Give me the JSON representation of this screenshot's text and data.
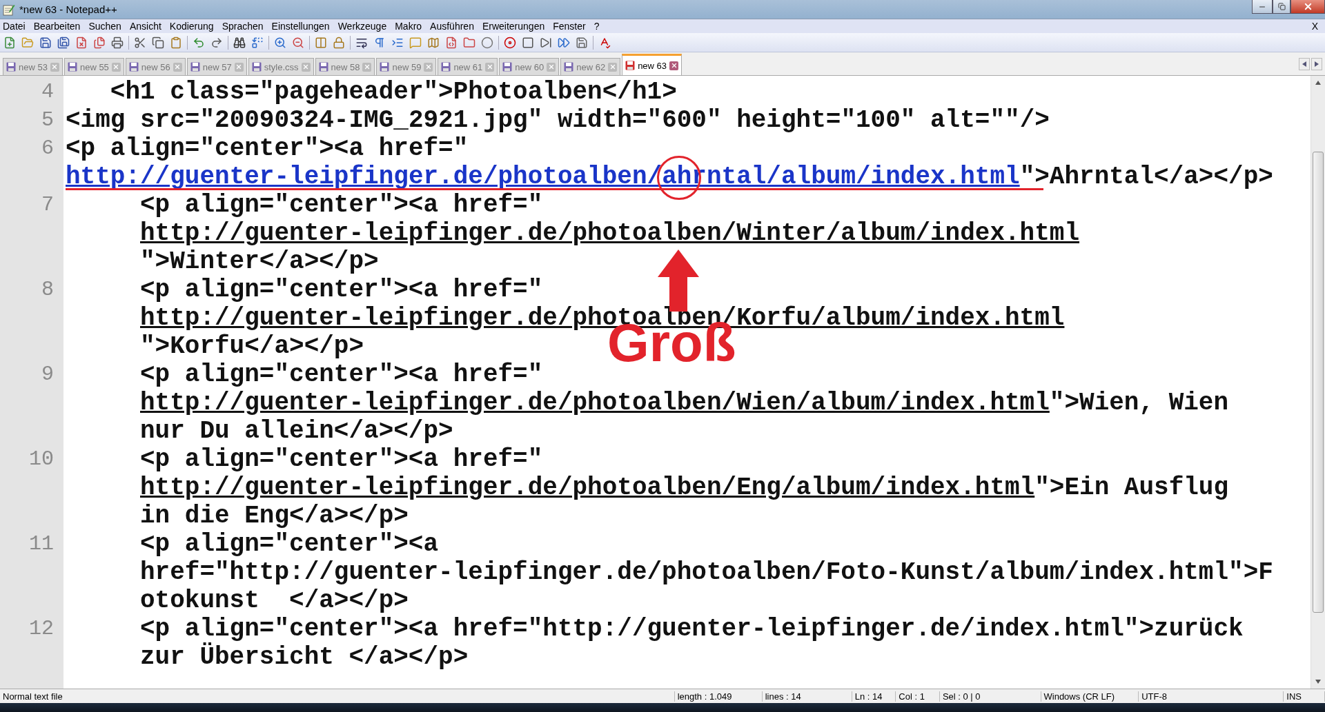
{
  "window": {
    "title": "*new 63 - Notepad++"
  },
  "menu": {
    "items": [
      "Datei",
      "Bearbeiten",
      "Suchen",
      "Ansicht",
      "Kodierung",
      "Sprachen",
      "Einstellungen",
      "Werkzeuge",
      "Makro",
      "Ausführen",
      "Erweiterungen",
      "Fenster",
      "?"
    ],
    "close": "X"
  },
  "tabs": [
    {
      "label": "new 53",
      "selected": false,
      "saved": true
    },
    {
      "label": "new 55",
      "selected": false,
      "saved": true
    },
    {
      "label": "new 56",
      "selected": false,
      "saved": true
    },
    {
      "label": "new 57",
      "selected": false,
      "saved": true
    },
    {
      "label": "style.css",
      "selected": false,
      "saved": true
    },
    {
      "label": "new 58",
      "selected": false,
      "saved": true
    },
    {
      "label": "new 59",
      "selected": false,
      "saved": true
    },
    {
      "label": "new 61",
      "selected": false,
      "saved": true
    },
    {
      "label": "new 60",
      "selected": false,
      "saved": true
    },
    {
      "label": "new 62",
      "selected": false,
      "saved": true
    },
    {
      "label": "new 63",
      "selected": true,
      "saved": false
    }
  ],
  "editor": {
    "lines": [
      {
        "number": "4",
        "indented": false,
        "rows": [
          [
            {
              "kind": "text",
              "text": "   <h1 class=\"pageheader\">Photoalben</h1>"
            }
          ]
        ]
      },
      {
        "number": "5",
        "indented": false,
        "rows": [
          [
            {
              "kind": "text",
              "text": "<img src=\"20090324-IMG_2921.jpg\" width=\"600\" height=\"100\" alt=\"\"/>"
            }
          ]
        ]
      },
      {
        "number": "6",
        "indented": false,
        "rows": [
          [
            {
              "kind": "text",
              "text": "<p align=\"center\"><a href=\""
            }
          ],
          [
            {
              "kind": "hover_link",
              "text": "http://guenter-leipfinger.de/photoalben/ahrntal/album/index.html"
            },
            {
              "kind": "text",
              "text": "\">Ahrntal</a></p>"
            }
          ]
        ]
      },
      {
        "number": "7",
        "indented": true,
        "rows": [
          [
            {
              "kind": "text",
              "text": "<p align=\"center\"><a href=\""
            }
          ],
          [
            {
              "kind": "link",
              "text": "http://guenter-leipfinger.de/photoalben/Winter/album/index.html"
            }
          ],
          [
            {
              "kind": "text",
              "text": "\">Winter</a></p>"
            }
          ]
        ]
      },
      {
        "number": "8",
        "indented": true,
        "rows": [
          [
            {
              "kind": "text",
              "text": "<p align=\"center\"><a href=\""
            }
          ],
          [
            {
              "kind": "link",
              "text": "http://guenter-leipfinger.de/photoalben/Korfu/album/index.html"
            }
          ],
          [
            {
              "kind": "text",
              "text": "\">Korfu</a></p>"
            }
          ]
        ]
      },
      {
        "number": "9",
        "indented": true,
        "rows": [
          [
            {
              "kind": "text",
              "text": "<p align=\"center\"><a href=\""
            }
          ],
          [
            {
              "kind": "link",
              "text": "http://guenter-leipfinger.de/photoalben/Wien/album/index.html"
            },
            {
              "kind": "text",
              "text": "\">Wien, Wien"
            }
          ],
          [
            {
              "kind": "text",
              "text": "nur Du allein</a></p>"
            }
          ]
        ]
      },
      {
        "number": "10",
        "indented": true,
        "rows": [
          [
            {
              "kind": "text",
              "text": "<p align=\"center\"><a href=\""
            }
          ],
          [
            {
              "kind": "link",
              "text": "http://guenter-leipfinger.de/photoalben/Eng/album/index.html"
            },
            {
              "kind": "text",
              "text": "\">Ein Ausflug"
            }
          ],
          [
            {
              "kind": "text",
              "text": "in die Eng</a></p>"
            }
          ]
        ]
      },
      {
        "number": "11",
        "indented": true,
        "rows": [
          [
            {
              "kind": "text",
              "text": "<p align=\"center\"><a"
            }
          ],
          [
            {
              "kind": "text",
              "text": "href=\"http://guenter-leipfinger.de/photoalben/Foto-Kunst/album/index.html\">F"
            }
          ],
          [
            {
              "kind": "text",
              "text": "otokunst  </a></p>"
            }
          ]
        ]
      },
      {
        "number": "12",
        "indented": true,
        "rows": [
          [
            {
              "kind": "text",
              "text": "<p align=\"center\"><a href=\"http://guenter-leipfinger.de/index.html\">zurück"
            }
          ],
          [
            {
              "kind": "text",
              "text": "zur Übersicht </a></p>"
            }
          ]
        ]
      }
    ]
  },
  "annotation": {
    "label": "Groß"
  },
  "status_bar": {
    "file_type": "Normal text file",
    "length": "length : 1.049",
    "lines": "lines : 14",
    "ln": "Ln : 14",
    "col": "Col : 1",
    "sel": "Sel : 0 | 0",
    "eol": "Windows (CR LF)",
    "encoding": "UTF-8",
    "mode": "INS"
  }
}
